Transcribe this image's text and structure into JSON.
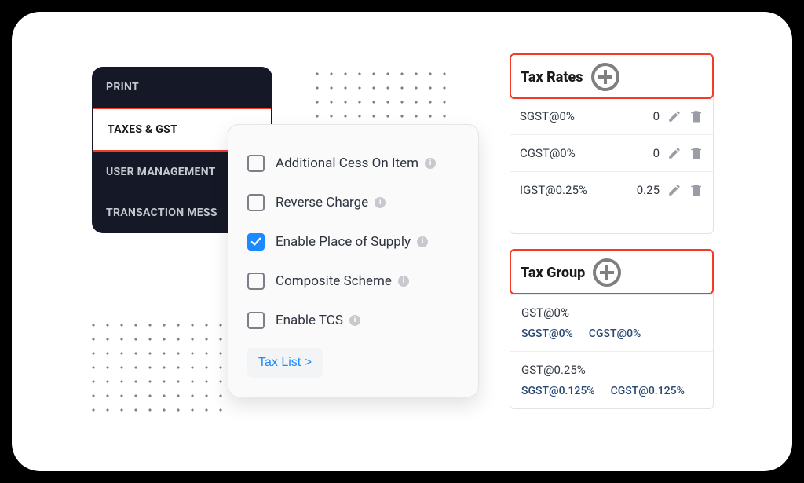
{
  "sidebar": {
    "items": [
      {
        "label": "PRINT",
        "active": false
      },
      {
        "label": "TAXES & GST",
        "active": true
      },
      {
        "label": "USER MANAGEMENT",
        "active": false
      },
      {
        "label": "TRANSACTION MESS",
        "active": false
      }
    ]
  },
  "settings": {
    "options": [
      {
        "label": "Additional Cess On Item",
        "checked": false
      },
      {
        "label": "Reverse Charge",
        "checked": false
      },
      {
        "label": "Enable Place of Supply",
        "checked": true
      },
      {
        "label": "Composite Scheme",
        "checked": false
      },
      {
        "label": "Enable TCS",
        "checked": false
      }
    ],
    "tax_list_button": "Tax List >"
  },
  "taxRates": {
    "title": "Tax Rates",
    "rows": [
      {
        "label": "SGST@0%",
        "value": "0"
      },
      {
        "label": "CGST@0%",
        "value": "0"
      },
      {
        "label": "IGST@0.25%",
        "value": "0.25"
      }
    ]
  },
  "taxGroups": {
    "title": "Tax Group",
    "rows": [
      {
        "label": "GST@0%",
        "parts": [
          "SGST@0%",
          "CGST@0%"
        ]
      },
      {
        "label": "GST@0.25%",
        "parts": [
          "SGST@0.125%",
          "CGST@0.125%"
        ]
      }
    ]
  }
}
